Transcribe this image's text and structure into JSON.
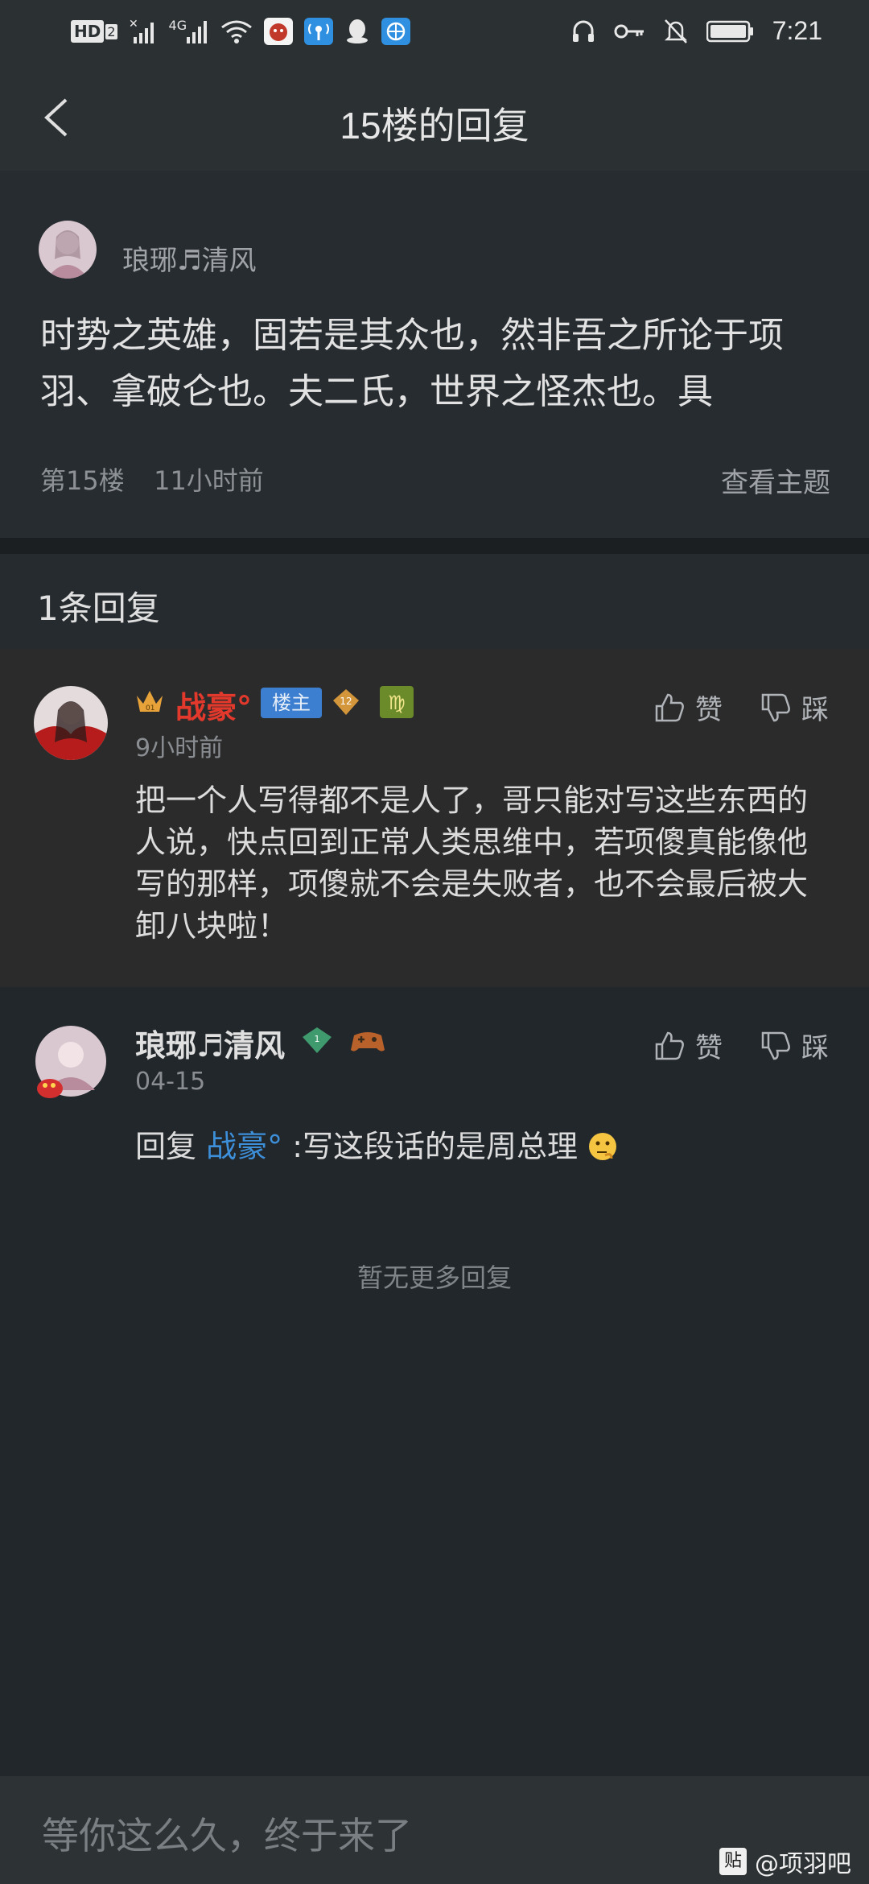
{
  "status_bar": {
    "hd_label": "HD",
    "sim": "2",
    "network": "4G",
    "time": "7:21"
  },
  "nav": {
    "title": "15楼的回复"
  },
  "post": {
    "author": "琅琊♬清风",
    "content": "时势之英雄，固若是其众也，然非吾之所论于项羽、拿破仑也。夫二氏，世界之怪杰也。具",
    "floor": "第15楼",
    "time": "11小时前",
    "view_topic": "查看主题"
  },
  "reply_count": "1条回复",
  "replies": [
    {
      "username": "战豪°",
      "badge_owner": "楼主",
      "level": "12",
      "time": "9小时前",
      "content": "把一个人写得都不是人了，哥只能对写这些东西的人说，快点回到正常人类思维中，若项傻真能像他写的那样，项傻就不会是失败者，也不会最后被大卸八块啦！",
      "like": "赞",
      "dislike": "踩"
    },
    {
      "username": "琅琊♬清风",
      "level": "1",
      "time": "04-15",
      "reply_prefix": "回复 ",
      "reply_to": "战豪°",
      "content": " :写这段话的是周总理",
      "like": "赞",
      "dislike": "踩"
    }
  ],
  "no_more": "暂无更多回复",
  "input": {
    "placeholder": "等你这么久，终于来了"
  },
  "watermark": {
    "icon_text": "贴",
    "text": "@项羽吧"
  },
  "colors": {
    "accent_red": "#e3392c",
    "link_blue": "#3d8fd9",
    "badge_blue": "#3c7fd0"
  }
}
